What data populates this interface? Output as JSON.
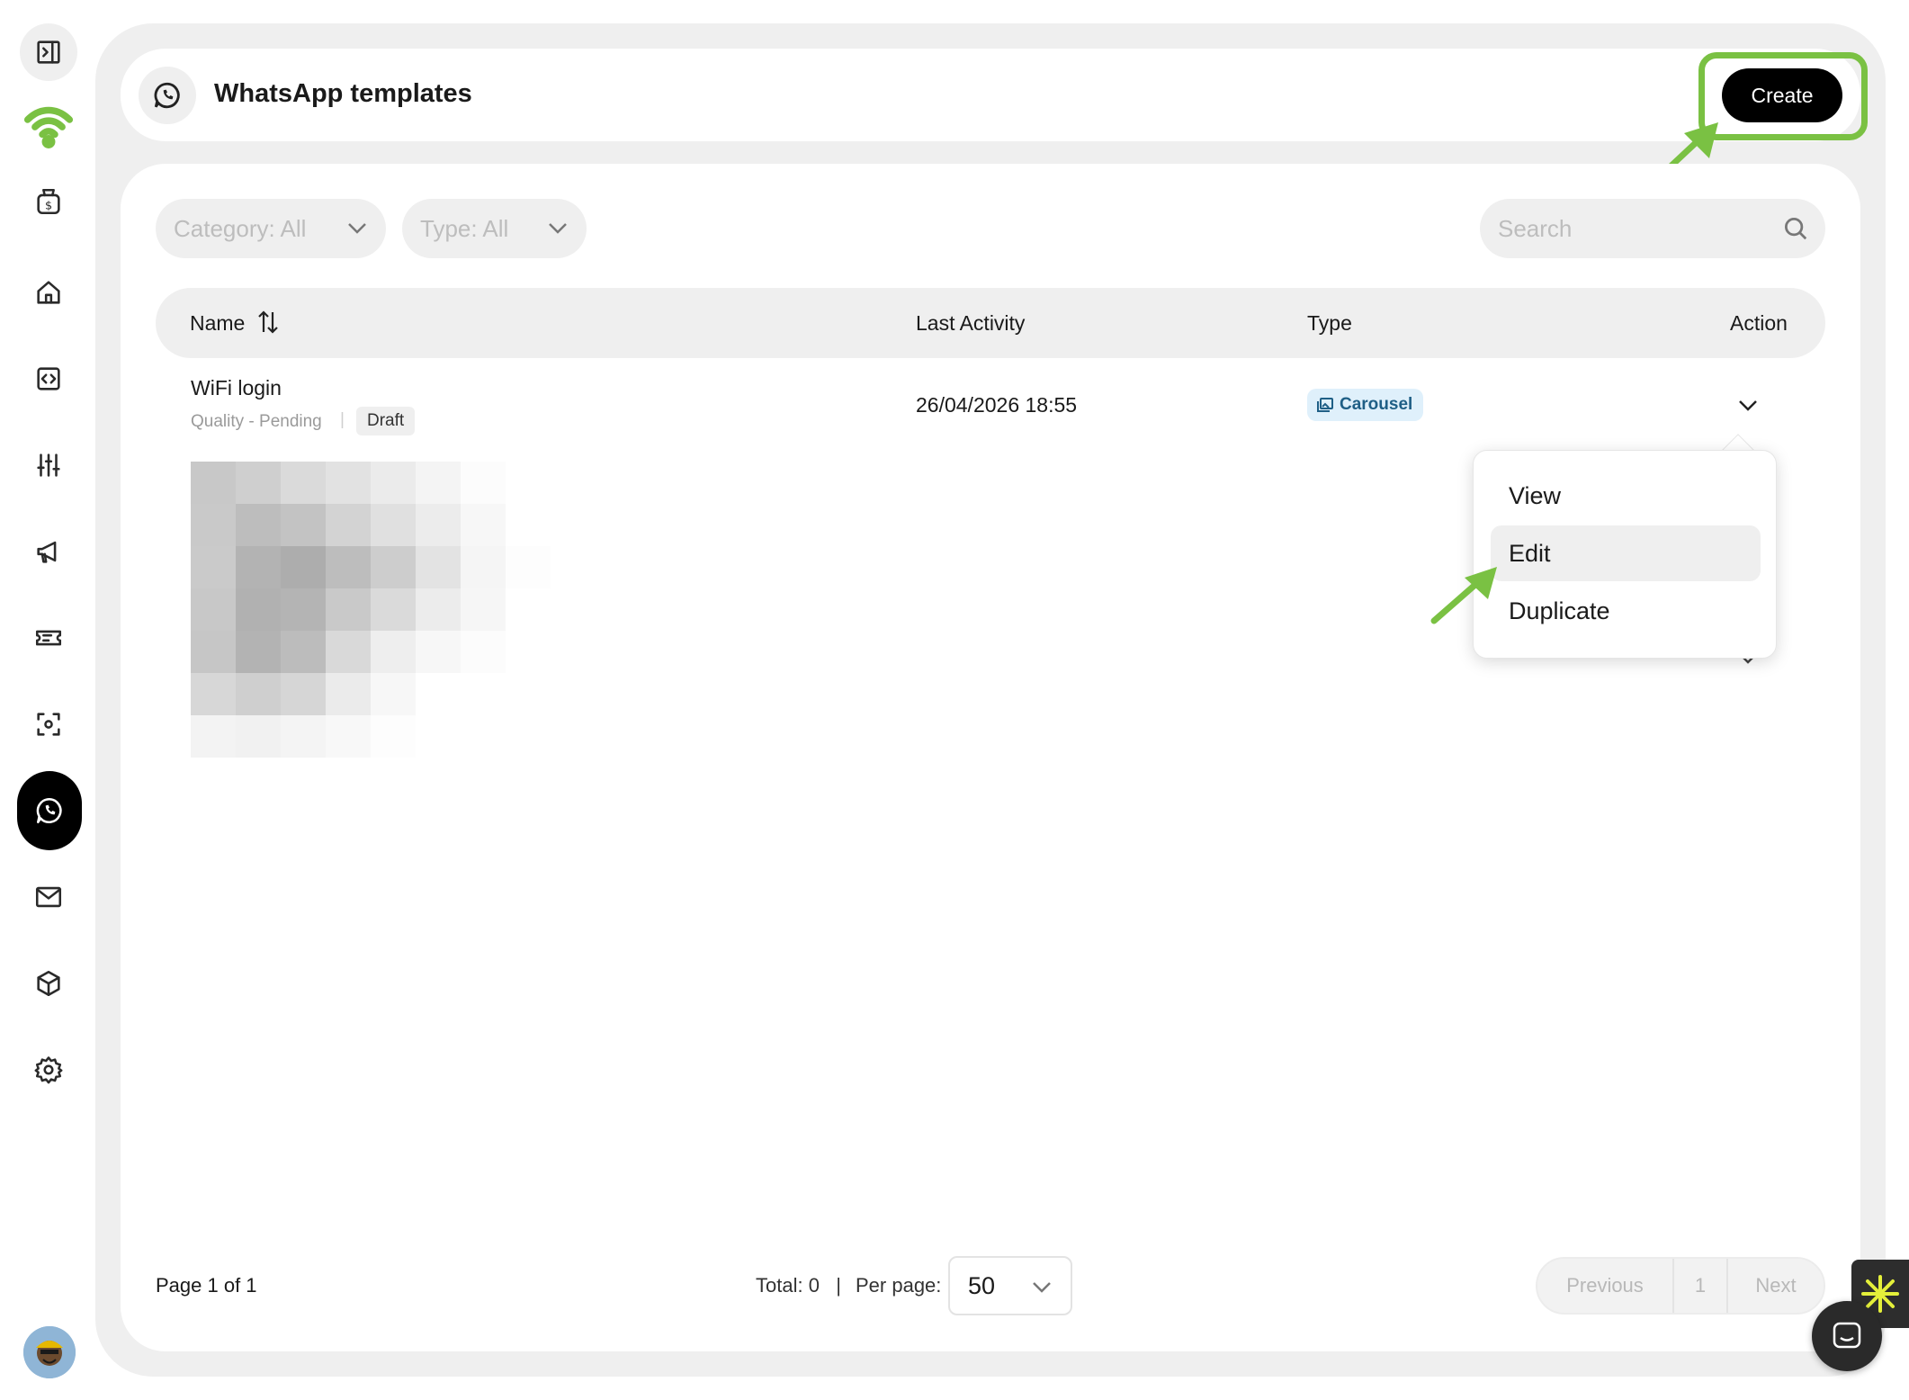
{
  "header": {
    "title": "WhatsApp templates",
    "create_label": "Create"
  },
  "filters": {
    "category": "Category: All",
    "type": "Type: All",
    "search_placeholder": "Search"
  },
  "table": {
    "columns": [
      "Name",
      "Last Activity",
      "Type",
      "Action"
    ],
    "rows": [
      {
        "name": "WiFi login",
        "quality": "Quality - Pending",
        "separator": "|",
        "status": "Draft",
        "last_activity": "26/04/2026 18:55",
        "type": "Carousel"
      }
    ]
  },
  "action_menu": {
    "items": [
      "View",
      "Edit",
      "Duplicate"
    ],
    "hovered": "Edit"
  },
  "footer": {
    "page_info": "Page 1 of 1",
    "total": "Total: 0",
    "separator": "|",
    "per_page_label": "Per page:",
    "per_page_value": "50",
    "previous": "Previous",
    "page_number": "1",
    "next": "Next"
  },
  "colors": {
    "highlight": "#7ac143",
    "brand_wifi": "#7ac143",
    "carousel_bg": "#dff0fb",
    "carousel_text": "#1f5f86",
    "primary_button": "#000000"
  },
  "icons": {
    "sidebar": [
      "sidebar-collapse-icon",
      "wifi-logo-icon",
      "money-bag-icon",
      "home-icon",
      "code-icon",
      "sliders-icon",
      "megaphone-icon",
      "ticket-icon",
      "scan-icon",
      "whatsapp-icon",
      "mail-icon",
      "cube-icon",
      "gear-icon"
    ]
  }
}
